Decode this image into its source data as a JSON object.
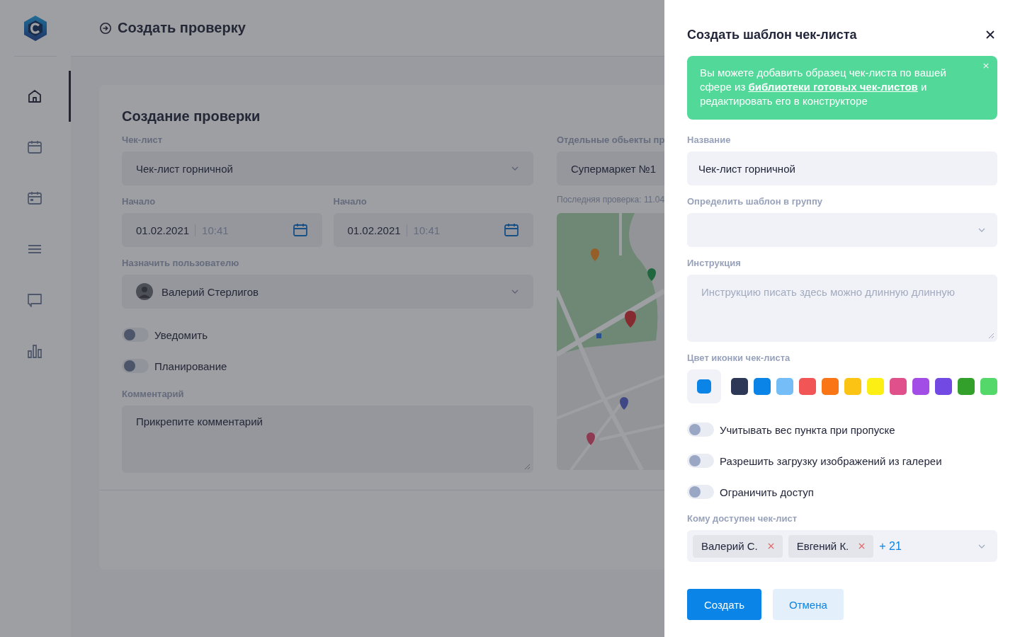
{
  "sidebar": {
    "items": [
      {
        "kind": "home",
        "selected": true
      },
      {
        "kind": "calendar",
        "selected": false
      },
      {
        "kind": "calendar-day",
        "selected": false
      },
      {
        "kind": "menu",
        "selected": false
      },
      {
        "kind": "chat",
        "selected": false
      },
      {
        "kind": "chart",
        "selected": false
      }
    ]
  },
  "header": {
    "title": "Создать проверку"
  },
  "form": {
    "title": "Создание проверки",
    "checklist": {
      "label": "Чек-лист",
      "value": "Чек-лист горничной"
    },
    "start_fields": [
      {
        "label": "Начало",
        "date": "01.02.2021",
        "time": "10:41"
      },
      {
        "label": "Начало",
        "date": "01.02.2021",
        "time": "10:41"
      }
    ],
    "assignee": {
      "label": "Назначить пользователю",
      "value": "Валерий Стерлигов"
    },
    "toggles": [
      {
        "label": "Уведомить",
        "on": false
      },
      {
        "label": "Планирование",
        "on": false
      }
    ],
    "comment": {
      "label": "Комментарий",
      "value": "Прикрепите комментарий"
    },
    "objects": {
      "label": "Отдельные обьекты пр",
      "value": "Супермаркет №1",
      "last_check": "Последняя проверка: 11.04"
    }
  },
  "drawer": {
    "title": "Создать шаблон чек-листа",
    "alert": {
      "text_before": "Вы можете добавить образец чек-листа по вашей сфере из",
      "link": "библиотеки готовых чек-листов",
      "text_after": "и редактировать его в конструкторе"
    },
    "name": {
      "label": "Название",
      "value": "Чек-лист горничной"
    },
    "group": {
      "label": "Определить шаблон в группу"
    },
    "instruction": {
      "label": "Инструкция",
      "placeholder": "Инструкцию писать здесь можно длинную длинную"
    },
    "icon_color": {
      "label": "Цвет иконки чек-листа",
      "preview": {
        "color": "#0a84e6"
      },
      "swatches": [
        {
          "color": "#2d3857"
        },
        {
          "color": "#0a84e6"
        },
        {
          "color": "#74bdf7"
        },
        {
          "color": "#f25555"
        },
        {
          "color": "#fa7516"
        },
        {
          "color": "#fbc414"
        },
        {
          "color": "#fbef14"
        },
        {
          "color": "#e0508a"
        },
        {
          "color": "#a24de6"
        },
        {
          "color": "#7349e3"
        },
        {
          "color": "#33a02c"
        },
        {
          "color": "#54d86a"
        }
      ]
    },
    "toggles": [
      {
        "label": "Учитывать вес пункта при пропуске",
        "on": false
      },
      {
        "label": "Разрешить загрузку изображений из галереи",
        "on": false
      },
      {
        "label": "Ограничить доступ",
        "on": false
      }
    ],
    "access": {
      "label": "Кому доступен чек-лист",
      "chips": [
        "Валерий С.",
        "Евгений К."
      ],
      "more": "+ 21"
    },
    "buttons": [
      {
        "kind": "primary",
        "label": "Создать"
      },
      {
        "kind": "secondary",
        "label": "Отмена"
      }
    ]
  }
}
